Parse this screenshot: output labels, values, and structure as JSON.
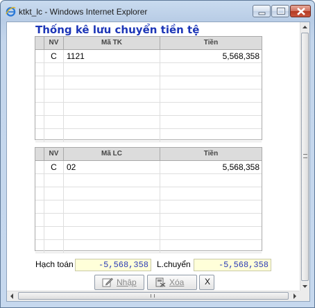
{
  "window": {
    "title": "ktkt_lc - Windows Internet Explorer"
  },
  "page": {
    "heading": "Thống kê lưu chuyển tiền tệ"
  },
  "grid_tk": {
    "headers": {
      "nv": "NV",
      "ma": "Mã TK",
      "tien": "Tiền"
    },
    "rows": [
      {
        "nv": "C",
        "ma": "1121",
        "tien": "5,568,358"
      },
      {
        "nv": "",
        "ma": "",
        "tien": ""
      },
      {
        "nv": "",
        "ma": "",
        "tien": ""
      },
      {
        "nv": "",
        "ma": "",
        "tien": ""
      },
      {
        "nv": "",
        "ma": "",
        "tien": ""
      },
      {
        "nv": "",
        "ma": "",
        "tien": ""
      },
      {
        "nv": "",
        "ma": "",
        "tien": ""
      }
    ]
  },
  "grid_lc": {
    "headers": {
      "nv": "NV",
      "ma": "Mã LC",
      "tien": "Tiền"
    },
    "rows": [
      {
        "nv": "C",
        "ma": "02",
        "tien": "5,568,358"
      },
      {
        "nv": "",
        "ma": "",
        "tien": ""
      },
      {
        "nv": "",
        "ma": "",
        "tien": ""
      },
      {
        "nv": "",
        "ma": "",
        "tien": ""
      },
      {
        "nv": "",
        "ma": "",
        "tien": ""
      },
      {
        "nv": "",
        "ma": "",
        "tien": ""
      },
      {
        "nv": "",
        "ma": "",
        "tien": ""
      }
    ]
  },
  "totals": {
    "hach_toan_label": "Hạch toán",
    "hach_toan_value": "-5,568,358",
    "luu_chuyen_label": "L.chuyển",
    "luu_chuyen_value": "-5,568,358"
  },
  "buttons": {
    "nhap": {
      "label": "Nhập",
      "icon": "edit-icon"
    },
    "xoa": {
      "label": "Xóa",
      "icon": "delete-icon"
    },
    "close": {
      "label": "X"
    }
  },
  "colors": {
    "heading": "#1d36b7",
    "field_bg": "#ffffd9",
    "field_text": "#2c3cb6"
  }
}
